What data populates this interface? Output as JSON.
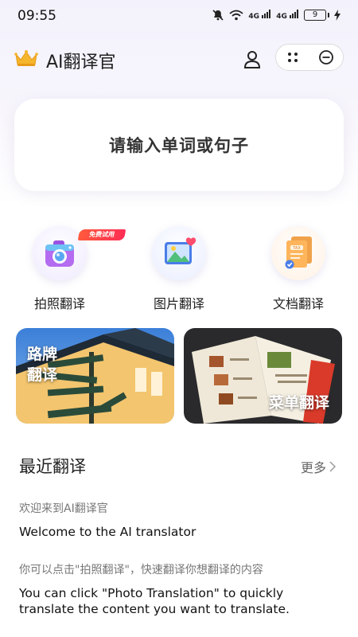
{
  "status_bar": {
    "time": "09:55",
    "signal_1": "4G",
    "signal_2": "4G",
    "battery": "9"
  },
  "header": {
    "app_title": "AI翻译官",
    "icons": [
      "crown-icon",
      "user-icon",
      "more-dots-icon",
      "minimize-icon"
    ]
  },
  "input": {
    "placeholder": "请输入单词或句子"
  },
  "features": [
    {
      "label": "拍照翻译",
      "badge": "免费试用",
      "icon": "camera-icon"
    },
    {
      "label": "图片翻译",
      "icon": "picture-icon"
    },
    {
      "label": "文档翻译",
      "icon": "document-icon"
    }
  ],
  "banners": [
    {
      "label": "路牌\n翻译",
      "line1": "路牌",
      "line2": "翻译"
    },
    {
      "label": "菜单翻译"
    }
  ],
  "recent": {
    "title": "最近翻译",
    "more": "更多",
    "items": [
      {
        "source": "欢迎来到AI翻译官",
        "target": "Welcome to the AI translator"
      },
      {
        "source": "你可以点击\"拍照翻译\"，快速翻译你想翻译的内容",
        "target": "You can click \"Photo Translation\" to quickly translate the content you want to translate."
      }
    ]
  },
  "colors": {
    "accent_orange": "#f5a623",
    "tag_red": "#ff3b3b",
    "text_dark": "#222222",
    "text_gray": "#777777"
  }
}
